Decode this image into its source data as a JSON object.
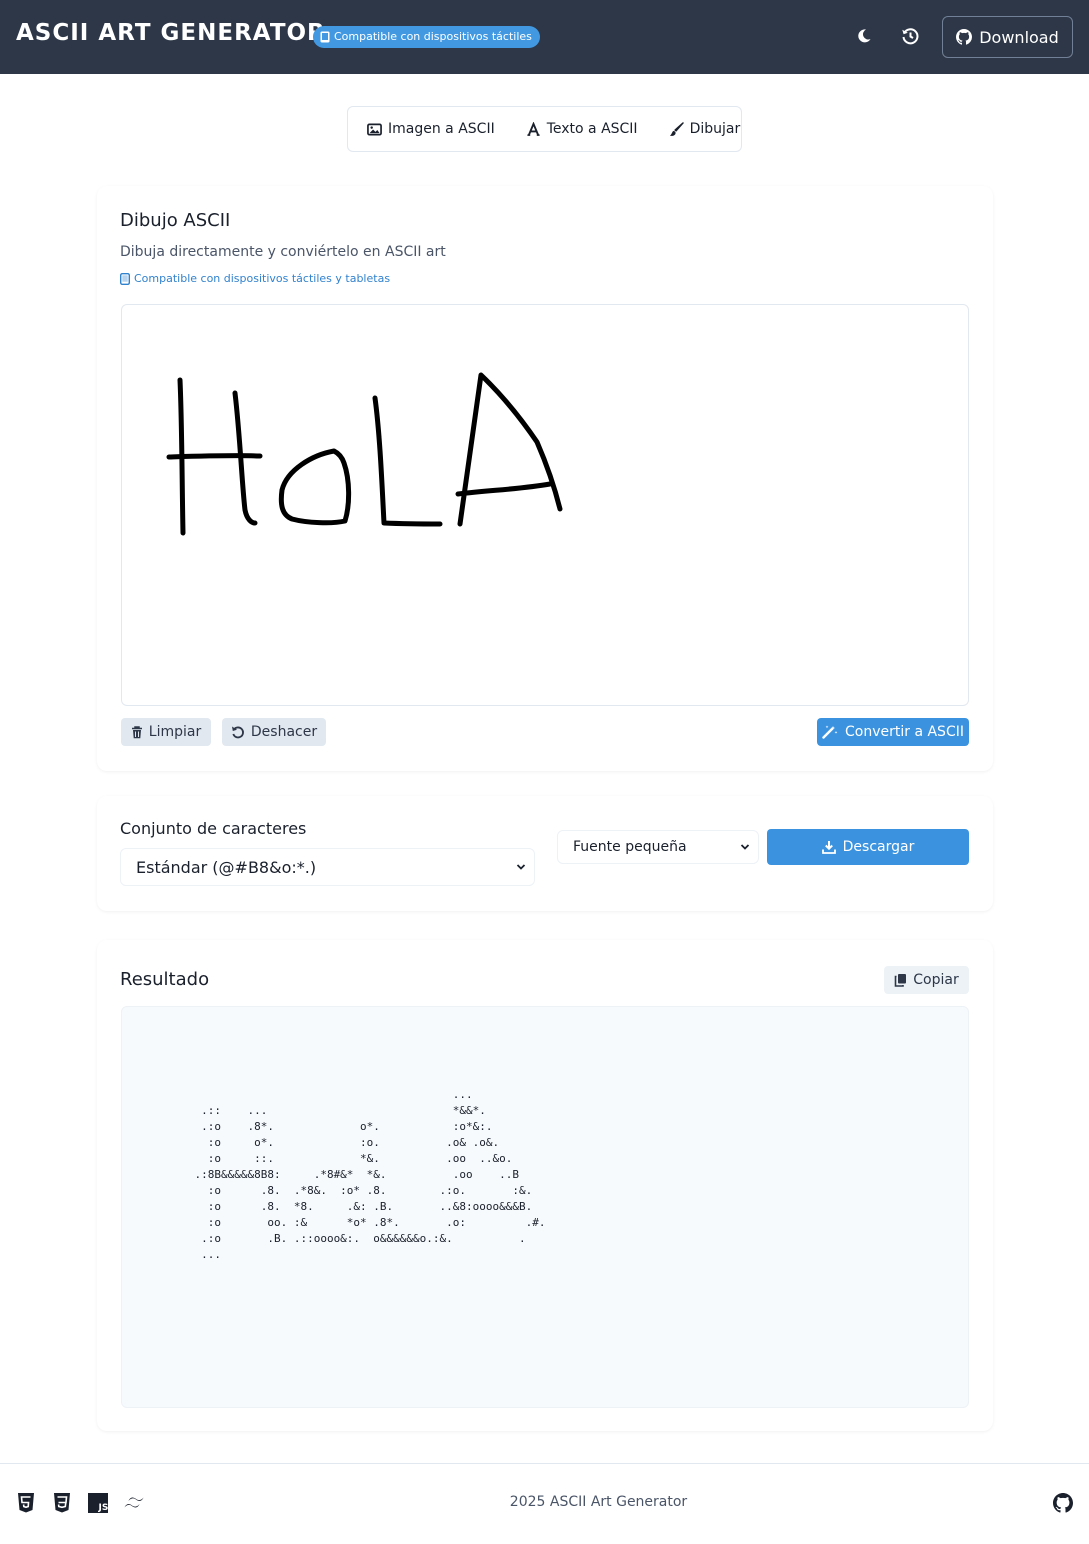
{
  "header": {
    "title": "ASCII ART GENERATOR",
    "badge": "Compatible con dispositivos táctiles",
    "theme_icon": "moon-icon",
    "history_icon": "history-icon",
    "download_label": "Download"
  },
  "tabs": [
    {
      "label": "Imagen a ASCII",
      "icon": "image-icon"
    },
    {
      "label": "Texto a ASCII",
      "icon": "font-icon"
    },
    {
      "label": "Dibujar",
      "icon": "brush-icon"
    }
  ],
  "draw_section": {
    "title": "Dibujo ASCII",
    "description": "Dibuja directamente y conviértelo en ASCII art",
    "touch_note": "Compatible con dispositivos táctiles y tabletas",
    "clear_label": "Limpiar",
    "undo_label": "Deshacer",
    "convert_label": "Convertir a ASCII"
  },
  "options": {
    "charset_label": "Conjunto de caracteres",
    "charset_value": "Estándar (@#B8&o:*.)",
    "font_value": "Fuente pequeña",
    "download_label": "Descargar"
  },
  "result": {
    "title": "Resultado",
    "copy_label": "Copiar",
    "ascii": "\n                                           ...\n     .::    ...                            *&&*.\n     .:o    .8*.             o*.           :o*&:.\n      :o     o*.             :o.          .o& .o&.\n      :o     ::.             *&.          .oo  ..&o.\n    .:8B&&&&&8B8:     .*8#&*  *&.          .oo    ..B\n      :o      .8.  .*8&.  :o* .8.        .:o.       :&.\n      :o      .8.  *8.     .&: .B.       ..&8:oooo&&&B.\n      :o       oo. :&      *o* .8*.       .o:         .#.\n     .:o       .B. .::oooo&:.  o&&&&&&o.:&.          .\n     ..."
  },
  "footer": {
    "text": "2025 ASCII Art Generator",
    "icons": [
      "html5-icon",
      "css3-icon",
      "javascript-icon",
      "tailwind-icon",
      "github-icon"
    ]
  }
}
